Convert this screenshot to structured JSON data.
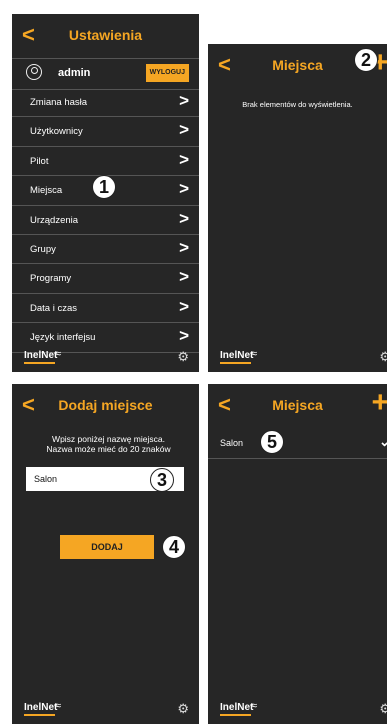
{
  "settings": {
    "back": "<",
    "title": "Ustawienia",
    "user": "admin",
    "logout": "WYLOGUJ",
    "items": [
      {
        "label": "Zmiana hasła"
      },
      {
        "label": "Użytkownicy"
      },
      {
        "label": "Pilot"
      },
      {
        "label": "Miejsca"
      },
      {
        "label": "Urządzenia"
      },
      {
        "label": "Grupy"
      },
      {
        "label": "Programy"
      },
      {
        "label": "Data i czas"
      },
      {
        "label": "Język interfejsu"
      }
    ],
    "chevron": ">"
  },
  "places_empty": {
    "back": "<",
    "title": "Miejsca",
    "add": "+",
    "empty_text": "Brak elementów do wyświetlenia."
  },
  "add_place": {
    "back": "<",
    "title": "Dodaj miejsce",
    "instruction_line1": "Wpisz poniżej nazwę miejsca.",
    "instruction_line2": "Nazwa może mieć do 20 znaków",
    "name_value": "Salon",
    "add_button": "DODAJ"
  },
  "places_list": {
    "back": "<",
    "title": "Miejsca",
    "add": "+",
    "items": [
      {
        "label": "Salon"
      }
    ]
  },
  "footer": {
    "logo": "InelNet",
    "wifi_icon": "wifi-icon",
    "gear_icon": "gear-icon"
  },
  "step_badges": [
    "1",
    "2",
    "3",
    "4",
    "5"
  ],
  "colors": {
    "accent": "#f5a623",
    "background": "#262626",
    "text": "#ffffff"
  }
}
